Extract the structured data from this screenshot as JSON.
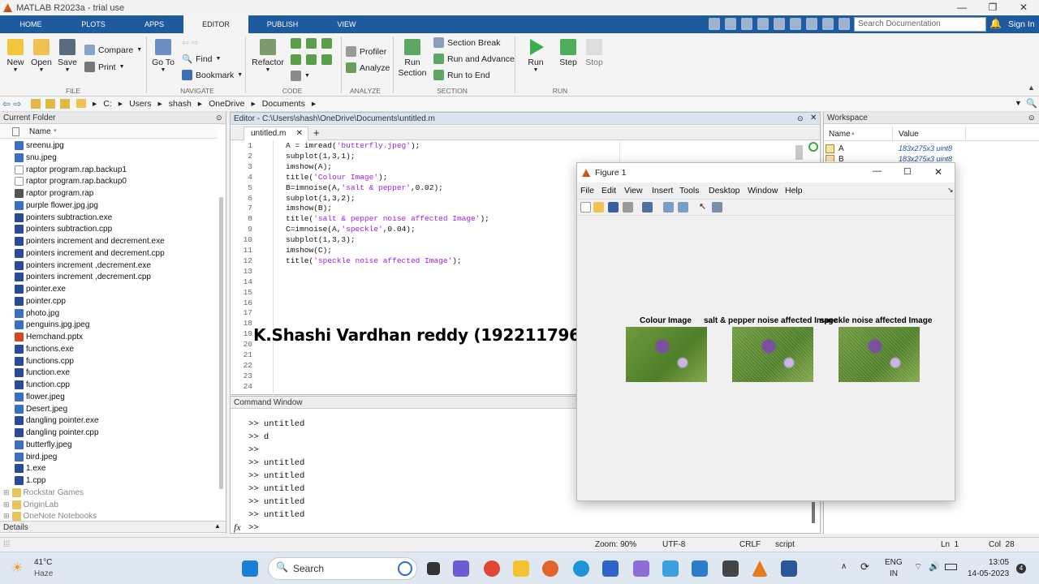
{
  "window": {
    "title": "MATLAB R2023a - trial use"
  },
  "tabs": [
    "HOME",
    "PLOTS",
    "APPS",
    "EDITOR",
    "PUBLISH",
    "VIEW"
  ],
  "search": {
    "placeholder": "Search Documentation"
  },
  "signin": "Sign In",
  "ribbon": {
    "file": {
      "new": "New",
      "open": "Open",
      "save": "Save",
      "compare": "Compare",
      "print": "Print",
      "group": "FILE"
    },
    "navigate": {
      "goto": "Go To",
      "find": "Find",
      "bookmark": "Bookmark",
      "group": "NAVIGATE"
    },
    "code": {
      "refactor": "Refactor",
      "group": "CODE"
    },
    "analyze": {
      "profiler": "Profiler",
      "analyze": "Analyze",
      "group": "ANALYZE"
    },
    "section": {
      "run_section": "Run Section",
      "section_break": "Section Break",
      "run_advance": "Run and Advance",
      "run_end": "Run to End",
      "group": "SECTION"
    },
    "run": {
      "run": "Run",
      "step": "Step",
      "stop": "Stop",
      "group": "RUN"
    }
  },
  "address": [
    "C:",
    "Users",
    "shash",
    "OneDrive",
    "Documents"
  ],
  "current_folder": {
    "title": "Current Folder",
    "col": "Name",
    "files": [
      "sreenu.jpg",
      "snu.jpeg",
      "raptor program.rap.backup1",
      "raptor program.rap.backup0",
      "raptor program.rap",
      "purple flower.jpg.jpg",
      "pointers subtraction.exe",
      "pointers subtraction.cpp",
      "pointers increment and decrement.exe",
      "pointers increment and decrement.cpp",
      "pointers increment ,decrement.exe",
      "pointers increment ,decrement.cpp",
      "pointer.exe",
      "pointer.cpp",
      "photo.jpg",
      "penguins.jpg.jpeg",
      "Hemchand.pptx",
      "functions.exe",
      "functions.cpp",
      "function.exe",
      "function.cpp",
      "flower.jpeg",
      "Desert.jpeg",
      "dangling pointer.exe",
      "dangling pointer.cpp",
      "butterfly.jpeg",
      "bird.jpeg",
      "1.exe",
      "1.cpp"
    ],
    "folders": [
      "Rockstar Games",
      "OriginLab",
      "OneNote Notebooks"
    ],
    "details": "Details"
  },
  "editor": {
    "title": "Editor - C:\\Users\\shash\\OneDrive\\Documents\\untitled.m",
    "tab": "untitled.m",
    "lines": [
      [
        "A = imread(",
        "'butterfly.jpeg'",
        ");"
      ],
      [
        "subplot(1,3,1);",
        "",
        ""
      ],
      [
        "imshow(A);",
        "",
        ""
      ],
      [
        "title(",
        "'Colour Image'",
        ");"
      ],
      [
        "B=imnoise(A,",
        "'salt & pepper'",
        ",0.02);"
      ],
      [
        "subplot(1,3,2);",
        "",
        ""
      ],
      [
        "imshow(B);",
        "",
        ""
      ],
      [
        "title(",
        "'salt & pepper noise affected Image'",
        ");"
      ],
      [
        "C=imnoise(A,",
        "'speckle'",
        ",0.04);"
      ],
      [
        "subplot(1,3,3);",
        "",
        ""
      ],
      [
        "imshow(C);",
        "",
        ""
      ],
      [
        "title(",
        "'speckle noise affected Image'",
        ");"
      ]
    ],
    "line_numbers": [
      "1",
      "2",
      "3",
      "4",
      "5",
      "6",
      "7",
      "8",
      "9",
      "10",
      "11",
      "12",
      "13",
      "14",
      "15",
      "16",
      "17",
      "18",
      "19",
      "20",
      "21",
      "22",
      "23",
      "24"
    ]
  },
  "overlay_text": "K.Shashi Vardhan reddy (192211796)",
  "command": {
    "title": "Command Window",
    "lines": [
      ">> untitled",
      ">> d",
      ">>",
      ">> untitled",
      ">> untitled",
      ">> untitled",
      ">> untitled",
      ">> untitled"
    ],
    "prompt": ">>",
    "fx": "fx"
  },
  "workspace": {
    "title": "Workspace",
    "col_name": "Name",
    "col_value": "Value",
    "rows": [
      {
        "name": "A",
        "value": "183x275x3 uint8"
      },
      {
        "name": "B",
        "value": "183x275x3 uint8"
      }
    ]
  },
  "figure": {
    "title": "Figure 1",
    "menu": [
      "File",
      "Edit",
      "View",
      "Insert",
      "Tools",
      "Desktop",
      "Window",
      "Help"
    ],
    "subplots": [
      "Colour Image",
      "salt & pepper noise affected Image",
      "speckle noise affected Image"
    ]
  },
  "status": {
    "zoom": "Zoom: 90%",
    "encoding": "UTF-8",
    "eol": "CRLF",
    "type": "script",
    "ln": "Ln  1",
    "col": "Col  28"
  },
  "taskbar": {
    "temp": "41°C",
    "weather": "Haze",
    "search": "Search",
    "lang1": "ENG",
    "lang2": "IN",
    "time": "13:05",
    "date": "14-05-2023",
    "badge": "4"
  }
}
